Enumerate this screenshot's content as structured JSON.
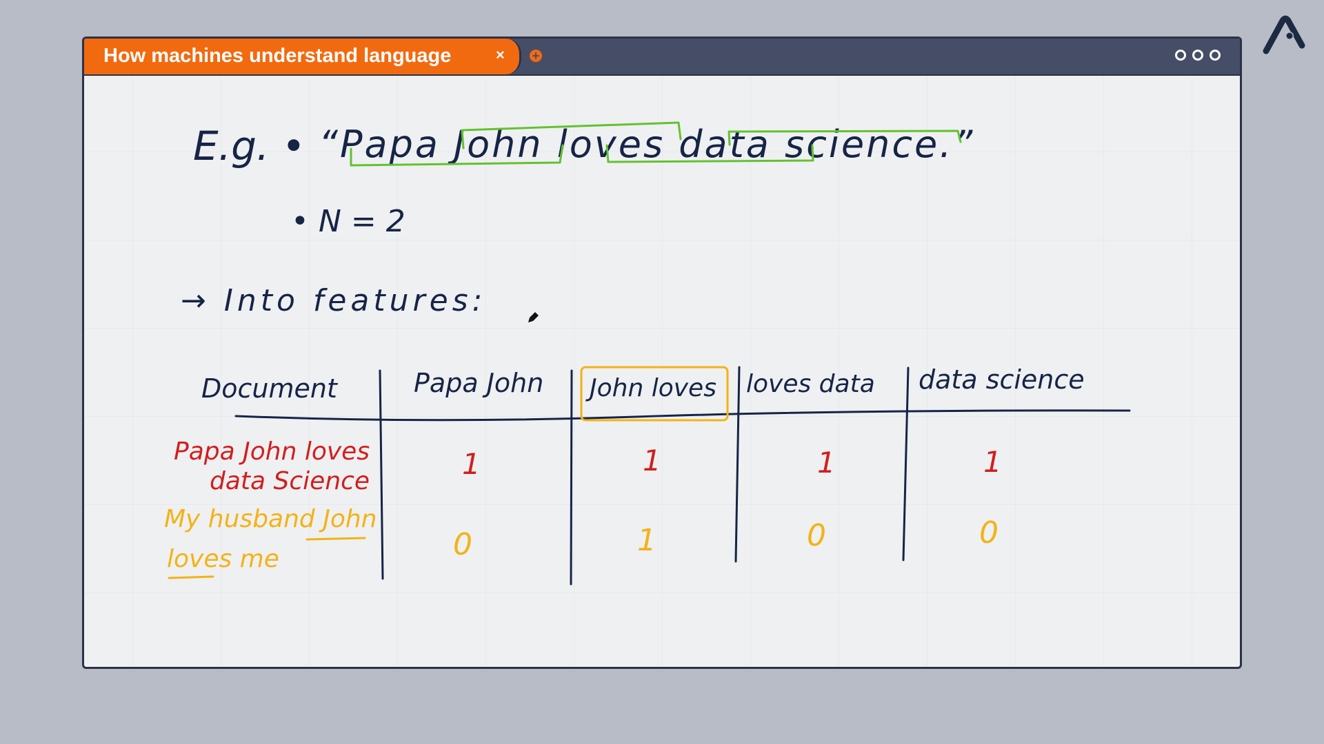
{
  "tab": {
    "title": "How machines understand language",
    "close_label": "×",
    "new_tab_label": "+"
  },
  "board": {
    "example_prefix": "E.g. •",
    "sentence": "“Papa John loves data science.”",
    "n_value": "• N = 2",
    "into_features": "→ Into features:",
    "table": {
      "headers": [
        "Document",
        "Papa John",
        "John loves",
        "loves data",
        "data science"
      ],
      "rows": [
        {
          "doc_line1": "Papa John loves",
          "doc_line2": "data Science",
          "values": [
            "1",
            "1",
            "1",
            "1"
          ]
        },
        {
          "doc_line1": "My husband John",
          "doc_line2": "loves me",
          "values": [
            "0",
            "1",
            "0",
            "0"
          ]
        }
      ]
    }
  },
  "colors": {
    "ink": "#162447",
    "red": "#d21e1e",
    "yellow": "#f2b316",
    "green": "#62c230",
    "orange": "#f26a10",
    "titlebar": "#454e66"
  }
}
